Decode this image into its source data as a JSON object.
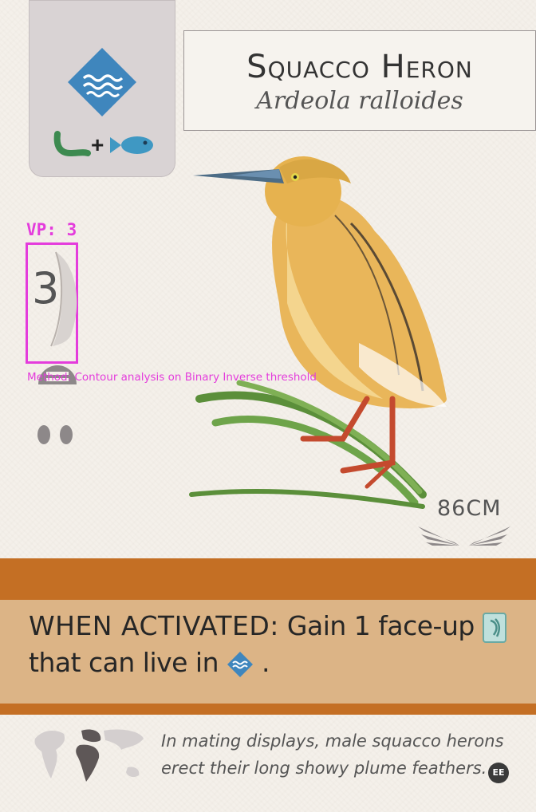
{
  "card": {
    "name": "Squacco Heron",
    "latin_name": "Ardeola ralloides",
    "habitat_icon": "wetland-icon",
    "food": {
      "icons": [
        "invertebrate-icon",
        "fish-icon"
      ],
      "separator": "+"
    },
    "nest_icon": "platform-nest-icon",
    "egg_icons": [
      "egg-icon",
      "egg-icon"
    ],
    "wingspan": "86CM",
    "power": {
      "heading": "WHEN ACTIVATED:",
      "text_before": "Gain 1 face-up",
      "text_middle": "that can live in",
      "text_end": ".",
      "icons": [
        "bird-card-icon",
        "wetland-icon"
      ]
    },
    "flavor_text": "In mating displays, male squacco herons erect their long showy plume feathers.",
    "expansion_badge": "EE",
    "colors": {
      "power_band": "#c46f24",
      "power_inner": "#dcb486",
      "wetland": "#3f86bd",
      "annotation": "#e43cdc"
    }
  },
  "overlay": {
    "vp_label": "VP: 3",
    "vp_value": "3",
    "method": "Method: Contour analysis on Binary Inverse threshold"
  }
}
